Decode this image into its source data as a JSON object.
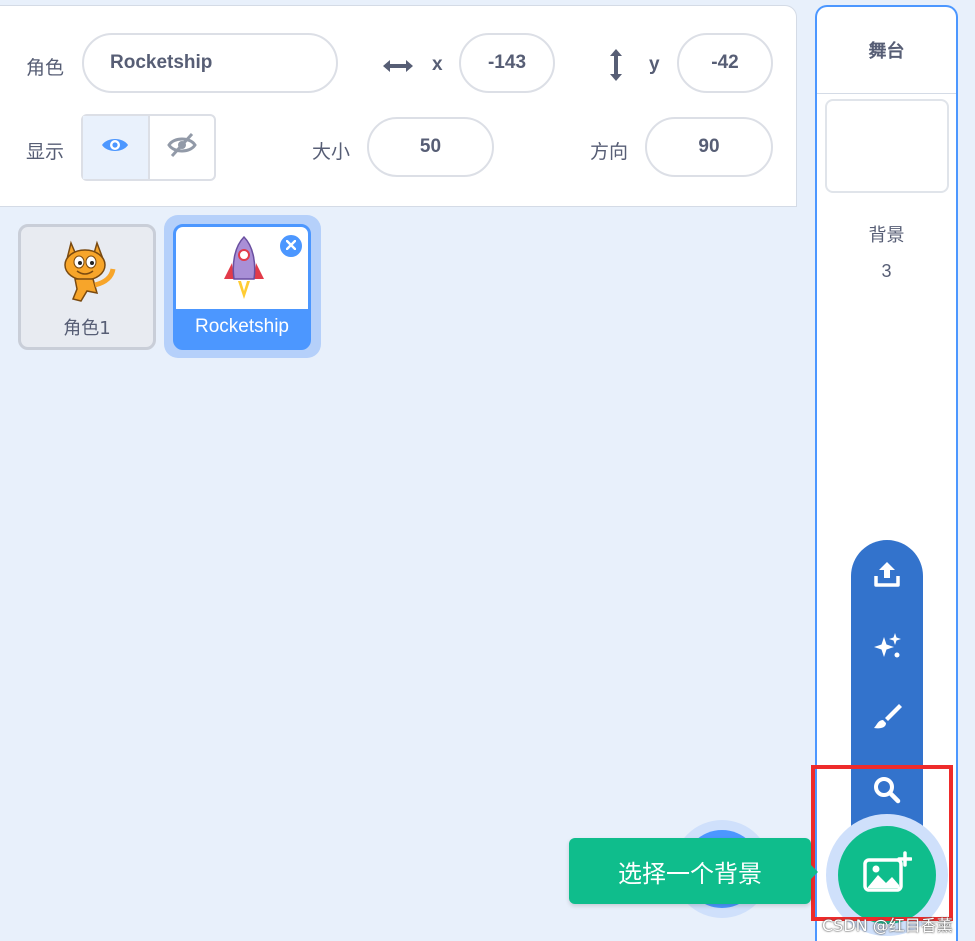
{
  "sprite_info": {
    "sprite_label": "角色",
    "sprite_name": "Rocketship",
    "x_label": "x",
    "x_value": "-143",
    "y_label": "y",
    "y_value": "-42",
    "show_label": "显示",
    "size_label": "大小",
    "size_value": "50",
    "direction_label": "方向",
    "direction_value": "90"
  },
  "sprites": [
    {
      "name": "角色1",
      "selected": false
    },
    {
      "name": "Rocketship",
      "selected": true
    }
  ],
  "stage": {
    "title": "舞台",
    "backdrops_label": "背景",
    "backdrops_count": "3"
  },
  "backdrop_menu": {
    "items": [
      "upload-icon",
      "surprise-icon",
      "paint-icon",
      "search-icon"
    ],
    "tooltip": "选择一个背景"
  },
  "watermark": "CSDN @红目香薰",
  "colors": {
    "accent": "#4c97ff",
    "menu_blue": "#3373cc",
    "green": "#0fbd8c",
    "highlight_red": "#ee2b2b"
  }
}
